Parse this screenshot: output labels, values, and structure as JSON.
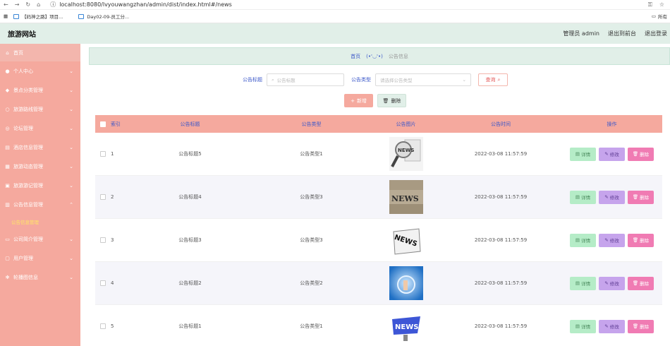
{
  "browser": {
    "url": "localhost:8080/lvyouwangzhan/admin/dist/index.html#/news",
    "bookmarks": [
      "【码神之路】项目...",
      "Day02-09-员工分..."
    ],
    "bookmarks_right": "所有"
  },
  "header": {
    "title": "旅游网站",
    "user": "管理员 admin",
    "to_front": "退出到前台",
    "logout": "退出登录"
  },
  "sidebar": {
    "items": [
      {
        "label": "首页"
      },
      {
        "label": "个人中心"
      },
      {
        "label": "景点分类管理"
      },
      {
        "label": "旅游路线管理"
      },
      {
        "label": "论坛管理"
      },
      {
        "label": "酒店信息管理"
      },
      {
        "label": "旅游动态管理"
      },
      {
        "label": "旅游游记管理"
      },
      {
        "label": "公告信息管理"
      },
      {
        "label": "公司简介管理"
      },
      {
        "label": "用户管理"
      },
      {
        "label": "轮播图信息"
      }
    ],
    "sub_active": "公告信息管理"
  },
  "breadcrumb": {
    "home": "首页",
    "sep": "(•'◡'•)",
    "current": "公告信息"
  },
  "search": {
    "title_label": "公告标题",
    "title_placeholder": "公告标题",
    "type_label": "公告类型",
    "type_placeholder": "请选择公告类型",
    "search_btn": "查询"
  },
  "actions": {
    "add": "新增",
    "delete": "删除"
  },
  "table": {
    "columns": [
      "索引",
      "公告标题",
      "公告类型",
      "公告图片",
      "公告时间",
      "操作"
    ],
    "rows": [
      {
        "idx": "1",
        "title": "公告标题5",
        "type": "公告类型1",
        "time": "2022-03-08 11:57:59"
      },
      {
        "idx": "2",
        "title": "公告标题4",
        "type": "公告类型3",
        "time": "2022-03-08 11:57:59"
      },
      {
        "idx": "3",
        "title": "公告标题3",
        "type": "公告类型3",
        "time": "2022-03-08 11:57:59"
      },
      {
        "idx": "4",
        "title": "公告标题2",
        "type": "公告类型2",
        "time": "2022-03-08 11:57:59"
      },
      {
        "idx": "5",
        "title": "公告标题1",
        "type": "公告类型1",
        "time": "2022-03-08 11:57:59"
      }
    ],
    "op_view": "详情",
    "op_edit": "修改",
    "op_del": "删除"
  },
  "colors": {
    "accent": "#f5a99e",
    "header_bg": "#e1efe8",
    "link": "#3a57c9"
  }
}
